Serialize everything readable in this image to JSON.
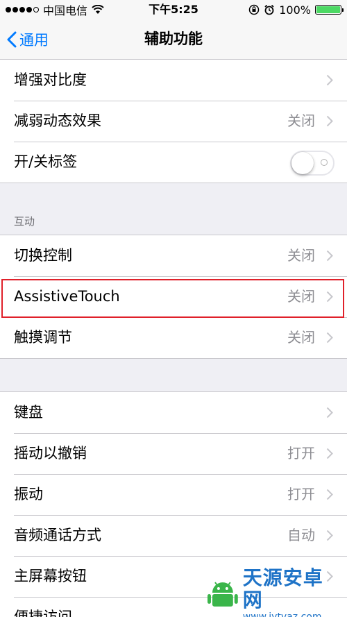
{
  "status_bar": {
    "carrier": "中国电信",
    "time": "下午5:25",
    "battery_percent": "100%",
    "icons": [
      "signal-dots-icon",
      "wifi-icon",
      "rotation-lock-icon",
      "alarm-icon",
      "battery-icon"
    ],
    "battery_color": "#4cd964"
  },
  "nav": {
    "back_label": "通用",
    "title": "辅助功能",
    "accent_color": "#007aff"
  },
  "group1": {
    "rows": [
      {
        "label": "增强对比度",
        "value": ""
      },
      {
        "label": "减弱动态效果",
        "value": "关闭"
      },
      {
        "label": "开/关标签",
        "toggle": false
      }
    ]
  },
  "interaction": {
    "header": "互动",
    "rows": [
      {
        "label": "切换控制",
        "value": "关闭"
      },
      {
        "label": "AssistiveTouch",
        "value": "关闭"
      },
      {
        "label": "触摸调节",
        "value": "关闭"
      }
    ]
  },
  "group3": {
    "rows": [
      {
        "label": "键盘",
        "value": ""
      },
      {
        "label": "摇动以撤销",
        "value": "打开"
      },
      {
        "label": "振动",
        "value": "打开"
      },
      {
        "label": "音频通话方式",
        "value": "自动"
      },
      {
        "label": "主屏幕按钮",
        "value": ""
      },
      {
        "label": "便捷访问",
        "value": ""
      }
    ]
  },
  "watermark": {
    "title": "天源安卓网",
    "url": "www.jytyaz.com"
  },
  "highlight_color": "#e0202a"
}
